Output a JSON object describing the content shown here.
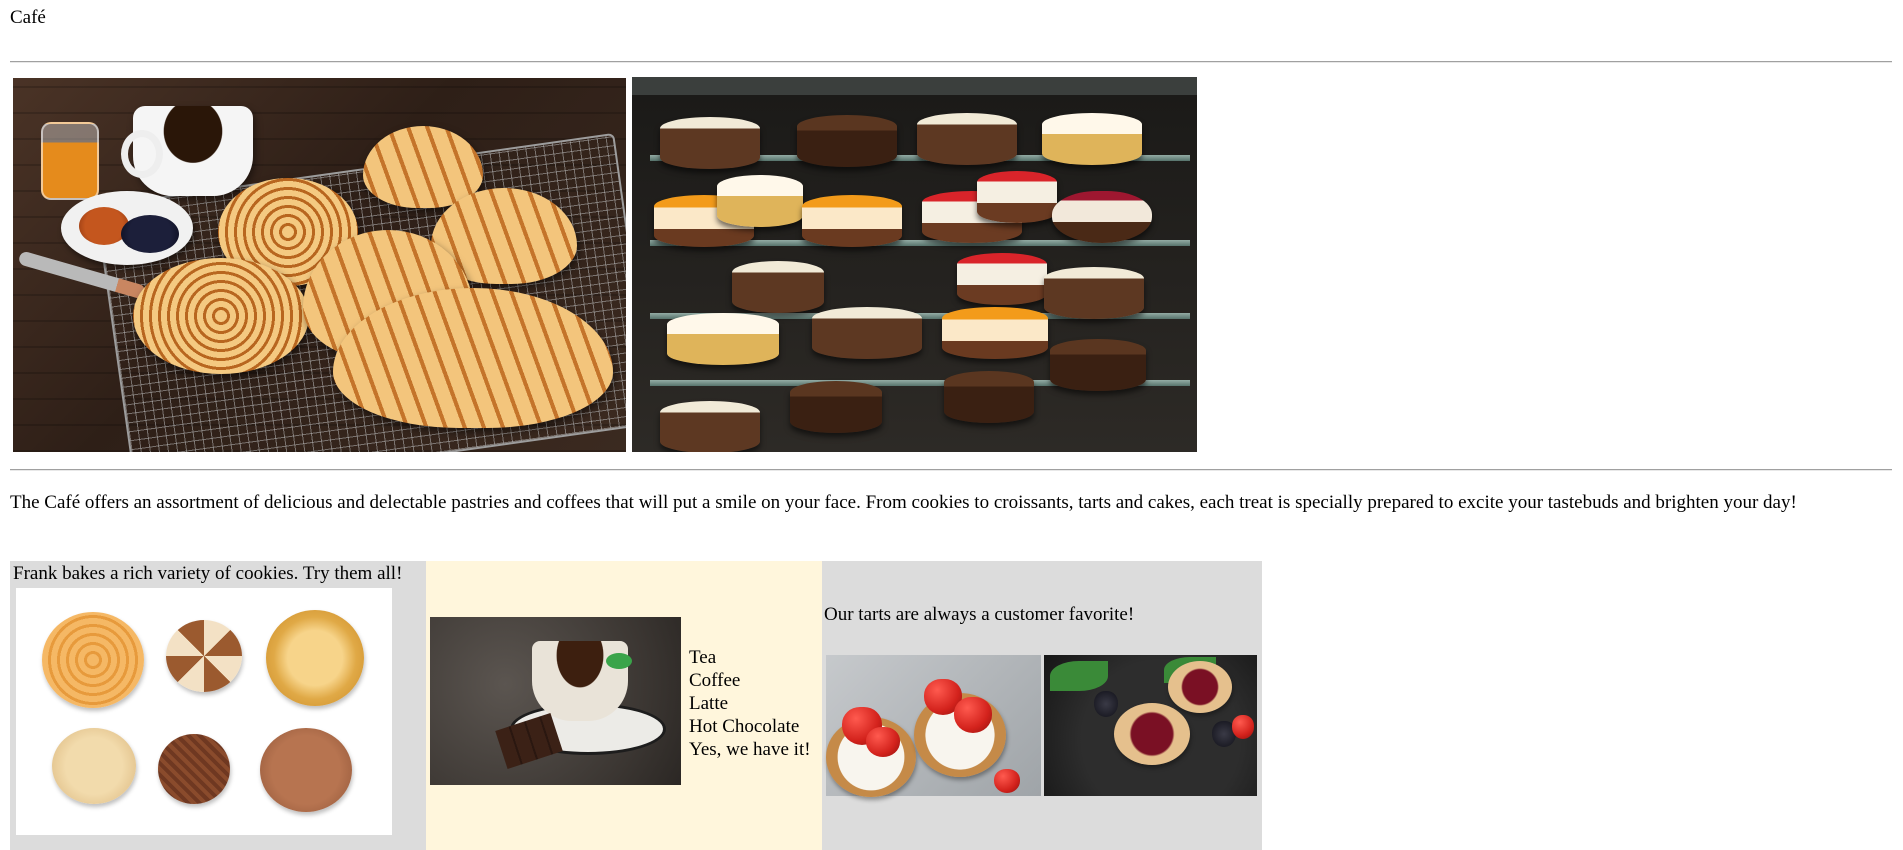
{
  "site": {
    "title": "Café"
  },
  "intro": {
    "text": "The Café offers an assortment of delicious and delectable pastries and coffees that will put a smile on your face. From cookies to croissants, tarts and cakes, each treat is specially prepared to excite your tastebuds and brighten your day!"
  },
  "hero_images": [
    {
      "name": "pastries-photo"
    },
    {
      "name": "cake-display-photo"
    }
  ],
  "panels": {
    "cookies": {
      "caption": "Frank bakes a rich variety of cookies. Try them all!",
      "background": "#dcdcdc"
    },
    "drinks": {
      "items": [
        "Tea",
        "Coffee",
        "Latte",
        "Hot Chocolate",
        "Yes, we have it!"
      ],
      "background": "#fff6dc"
    },
    "tarts": {
      "caption": "Our tarts are always a customer favorite!",
      "background": "#dcdcdc"
    }
  }
}
